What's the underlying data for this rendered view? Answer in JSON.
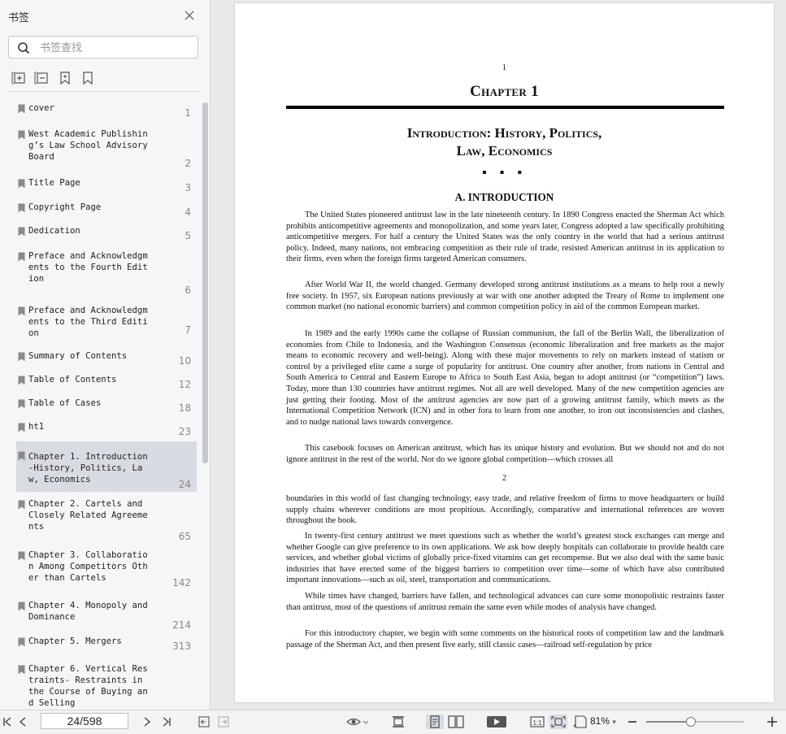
{
  "sidebar": {
    "title": "书签",
    "search_placeholder": "书签查找",
    "bookmarks": [
      {
        "label": "cover",
        "page": "1"
      },
      {
        "label": "West Academic Publishing’s Law School Advisory Board",
        "page": "2"
      },
      {
        "label": "Title Page",
        "page": "3"
      },
      {
        "label": "Copyright Page",
        "page": "4"
      },
      {
        "label": "Dedication",
        "page": "5"
      },
      {
        "label": "Preface and Acknowledgments to the Fourth Edition",
        "page": "6"
      },
      {
        "label": "Preface and Acknowledgments to the Third Edition",
        "page": "7"
      },
      {
        "label": "Summary of Contents",
        "page": "10"
      },
      {
        "label": "Table of Contents",
        "page": "12"
      },
      {
        "label": "Table of Cases",
        "page": "18"
      },
      {
        "label": "ht1",
        "page": "23"
      },
      {
        "label": "Chapter 1. Introduction-History, Politics, Law, Economics",
        "page": "24",
        "active": true
      },
      {
        "label": "Chapter 2. Cartels and Closely Related Agreements",
        "page": "65"
      },
      {
        "label": "Chapter 3. Collaboration Among Competitors Other than Cartels",
        "page": "142"
      },
      {
        "label": "Chapter 4. Monopoly and Dominance",
        "page": "214"
      },
      {
        "label": "Chapter 5. Mergers",
        "page": "313"
      },
      {
        "label": "Chapter 6. Vertical Restraints- Restraints in the Course of Buying and Selling",
        "page": ""
      }
    ]
  },
  "document": {
    "page_number_top": "1",
    "chapter": "Chapter 1",
    "title_line1": "Introduction: History, Politics,",
    "title_line2": "Law, Economics",
    "ornament": "▪ ▪ ▪",
    "section": "A. INTRODUCTION",
    "paragraphs": [
      "The United States pioneered antitrust law in the late nineteenth century. In 1890 Congress enacted the Sherman Act which prohibits anticompetitive agreements and monopolization, and some years later, Congress adopted a law specifically prohibiting anticompetitive mergers. For half a century the United States was the only country in the world that had a serious antitrust policy. Indeed, many nations, not embracing competition as their rule of trade, resisted American antitrust in its application to their firms, even when the foreign firms targeted American consumers.",
      "After World War II, the world changed. Germany developed strong antitrust institutions as a means to help root a newly free society. In 1957, six European nations previously at war with one another adopted the Treaty of Rome to implement one common market (no national economic barriers) and common competition policy in aid of the common European market.",
      "In 1989 and the early 1990s came the collapse of Russian communism, the fall of the Berlin Wall, the liberalization of economies from Chile to Indonesia, and the Washington Consensus (economic liberalization and free markets as the major means to economic recovery and well-being). Along with these major movements to rely on markets instead of statism or control by a privileged elite came a surge of popularity for antitrust. One country after another, from nations in Central and South America to Central and Eastern Europe to Africa to South East Asia, began to adopt antitrust (or “competition”) laws. Today, more than 130 countries have antitrust regimes. Not all are well developed. Many of the new competition agencies are just getting their footing. Most of the antitrust agencies are now part of a growing antitrust family, which meets as the International Competition Network (ICN) and in other fora to learn from one another, to iron out inconsistencies and clashes, and to nudge national laws towards convergence.",
      "This casebook focuses on American antitrust, which has its unique history and evolution. But we should not and do not ignore antitrust in the rest of the world. Nor do we ignore global competition—which crosses all"
    ],
    "page_number_2": "2",
    "paragraphs2": [
      "boundaries in this world of fast changing technology, easy trade, and relative freedom of firms to move headquarters or build supply chains wherever conditions are most propitious. Accordingly, comparative and international references are woven throughout the book.",
      "In twenty-first century antitrust we meet questions such as whether the world’s greatest stock exchanges can merge and whether Google can give preference to its own applications. We ask how deeply hospitals can collaborate to provide health care services, and whether global victims of globally price-fixed vitamins can get recompense. But we also deal with the same basic industries that have erected some of the biggest barriers to competition over time—some of which have also contributed important innovations—such as oil, steel, transportation and communications.",
      "While times have changed, barriers have fallen, and technological advances can cure some monopolistic restraints faster than antitrust, most of the questions of antitrust remain the same even while modes of analysis have changed.",
      "For this introductory chapter, we begin with some comments on the historical roots of competition law and the landmark passage of the Sherman Act, and then present five early, still classic cases—railroad self-regulation by price"
    ]
  },
  "toolbar": {
    "page_indicator": "24/598",
    "zoom": "81%",
    "zoom_fraction": 0.46
  }
}
